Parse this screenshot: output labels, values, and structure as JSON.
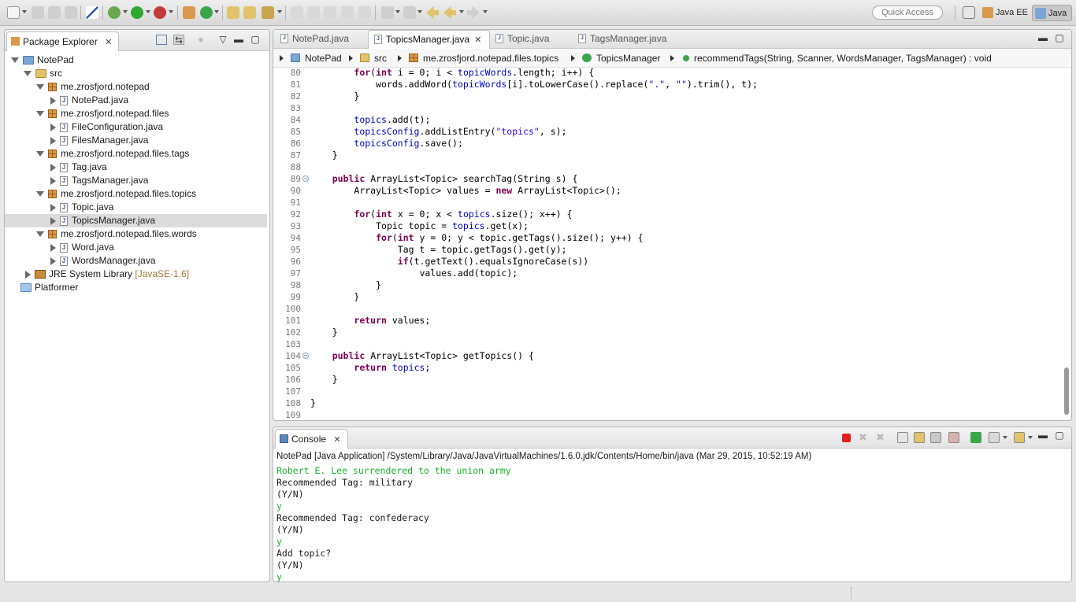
{
  "toolbar": {
    "quick_access_placeholder": "Quick Access",
    "perspectives": [
      {
        "label": "Java EE",
        "icon": "java-ee-perspective-icon"
      },
      {
        "label": "Java",
        "icon": "java-perspective-icon",
        "active": true
      }
    ]
  },
  "package_explorer": {
    "title": "Package Explorer",
    "tree": [
      {
        "label": "NotePad",
        "kind": "project"
      },
      {
        "label": "src",
        "kind": "source-folder"
      },
      {
        "label": "me.zrosfjord.notepad",
        "kind": "package"
      },
      {
        "label": "NotePad.java",
        "kind": "java-file"
      },
      {
        "label": "me.zrosfjord.notepad.files",
        "kind": "package"
      },
      {
        "label": "FileConfiguration.java",
        "kind": "java-file"
      },
      {
        "label": "FilesManager.java",
        "kind": "java-file"
      },
      {
        "label": "me.zrosfjord.notepad.files.tags",
        "kind": "package"
      },
      {
        "label": "Tag.java",
        "kind": "java-file"
      },
      {
        "label": "TagsManager.java",
        "kind": "java-file"
      },
      {
        "label": "me.zrosfjord.notepad.files.topics",
        "kind": "package"
      },
      {
        "label": "Topic.java",
        "kind": "java-file"
      },
      {
        "label": "TopicsManager.java",
        "kind": "java-file",
        "selected": true
      },
      {
        "label": "me.zrosfjord.notepad.files.words",
        "kind": "package"
      },
      {
        "label": "Word.java",
        "kind": "java-file"
      },
      {
        "label": "WordsManager.java",
        "kind": "java-file"
      },
      {
        "label": "JRE System Library",
        "suffix": "[JavaSE-1.6]",
        "kind": "library"
      },
      {
        "label": "Platformer",
        "kind": "folder"
      }
    ]
  },
  "editor": {
    "tabs": [
      {
        "label": "NotePad.java"
      },
      {
        "label": "TopicsManager.java",
        "active": true
      },
      {
        "label": "Topic.java"
      },
      {
        "label": "TagsManager.java"
      }
    ],
    "breadcrumb": [
      "NotePad",
      "src",
      "me.zrosfjord.notepad.files.topics",
      "TopicsManager",
      "recommendTags(String, Scanner, WordsManager, TagsManager) : void"
    ],
    "lines": [
      {
        "n": "80",
        "code": "        for(int i = 0; i < topicWords.length; i++) {"
      },
      {
        "n": "81",
        "code": "            words.addWord(topicWords[i].toLowerCase().replace(\".\", \"\").trim(), t);"
      },
      {
        "n": "82",
        "code": "        }"
      },
      {
        "n": "83",
        "code": ""
      },
      {
        "n": "84",
        "code": "        topics.add(t);"
      },
      {
        "n": "85",
        "code": "        topicsConfig.addListEntry(\"topics\", s);"
      },
      {
        "n": "86",
        "code": "        topicsConfig.save();"
      },
      {
        "n": "87",
        "code": "    }"
      },
      {
        "n": "88",
        "code": ""
      },
      {
        "n": "89",
        "code": "    public ArrayList<Topic> searchTag(String s) {",
        "fold": true
      },
      {
        "n": "90",
        "code": "        ArrayList<Topic> values = new ArrayList<Topic>();"
      },
      {
        "n": "91",
        "code": ""
      },
      {
        "n": "92",
        "code": "        for(int x = 0; x < topics.size(); x++) {"
      },
      {
        "n": "93",
        "code": "            Topic topic = topics.get(x);"
      },
      {
        "n": "94",
        "code": "            for(int y = 0; y < topic.getTags().size(); y++) {"
      },
      {
        "n": "95",
        "code": "                Tag t = topic.getTags().get(y);"
      },
      {
        "n": "96",
        "code": "                if(t.getText().equalsIgnoreCase(s))"
      },
      {
        "n": "97",
        "code": "                    values.add(topic);"
      },
      {
        "n": "98",
        "code": "            }"
      },
      {
        "n": "99",
        "code": "        }"
      },
      {
        "n": "100",
        "code": ""
      },
      {
        "n": "101",
        "code": "        return values;"
      },
      {
        "n": "102",
        "code": "    }"
      },
      {
        "n": "103",
        "code": ""
      },
      {
        "n": "104",
        "code": "    public ArrayList<Topic> getTopics() {",
        "fold": true
      },
      {
        "n": "105",
        "code": "        return topics;"
      },
      {
        "n": "106",
        "code": "    }"
      },
      {
        "n": "107",
        "code": ""
      },
      {
        "n": "108",
        "code": "}"
      },
      {
        "n": "109",
        "code": ""
      }
    ]
  },
  "console": {
    "title": "Console",
    "header": "NotePad [Java Application] /System/Library/Java/JavaVirtualMachines/1.6.0.jdk/Contents/Home/bin/java (Mar 29, 2015, 10:52:19 AM)",
    "output": [
      {
        "text": "Robert E. Lee surrendered to the union army",
        "input": true
      },
      {
        "text": "Recommended Tag: military",
        "input": false
      },
      {
        "text": "(Y/N)",
        "input": false
      },
      {
        "text": "y",
        "input": true
      },
      {
        "text": "Recommended Tag: confederacy",
        "input": false
      },
      {
        "text": "(Y/N)",
        "input": false
      },
      {
        "text": "y",
        "input": true
      },
      {
        "text": "Add topic?",
        "input": false
      },
      {
        "text": "(Y/N)",
        "input": false
      },
      {
        "text": "y",
        "input": true
      }
    ]
  },
  "colors": {
    "keyword": "#7f0055",
    "field": "#0000c0",
    "string": "#2a00ff",
    "console_input": "#1eb02e"
  }
}
